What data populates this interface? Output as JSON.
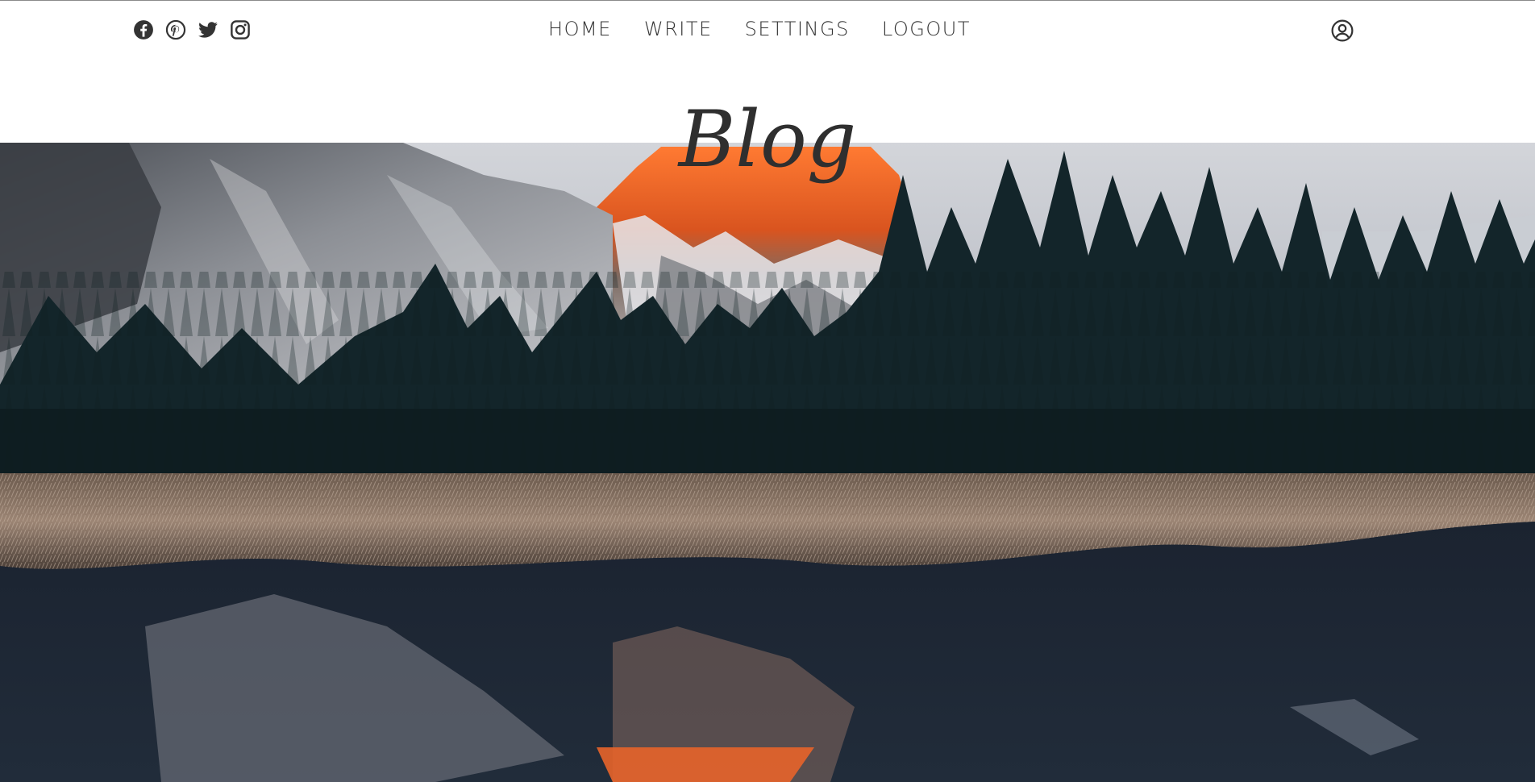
{
  "header": {
    "social": [
      "facebook-icon",
      "pinterest-icon",
      "twitter-icon",
      "instagram-icon"
    ],
    "nav": {
      "home": "HOME",
      "write": "WRITE",
      "settings": "SETTINGS",
      "logout": "LOGOUT"
    },
    "user_icon": "user-circle-icon"
  },
  "hero": {
    "title": "Blog",
    "image": "mountain-forest-lake-photo"
  },
  "colors": {
    "text": "#333333",
    "title": "#2f2f2f",
    "peak": "#e8642a"
  }
}
